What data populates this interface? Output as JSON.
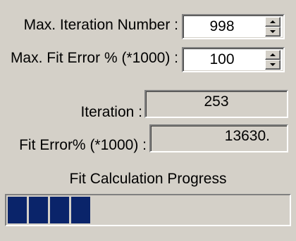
{
  "settings": {
    "max_iteration": {
      "label": "Max. Iteration Number :",
      "value": "998"
    },
    "max_fit_error": {
      "label": "Max. Fit Error % (*1000) :",
      "value": "100"
    }
  },
  "status": {
    "iteration": {
      "label": "Iteration :",
      "value": "253"
    },
    "fit_error": {
      "label": "Fit Error% (*1000) :",
      "value": "13630."
    }
  },
  "progress": {
    "label": "Fit Calculation Progress",
    "chunks_filled": 4,
    "bar_color": "#0a246a"
  },
  "icons": {
    "spin_up": "arrow-up-icon",
    "spin_down": "arrow-down-icon"
  }
}
